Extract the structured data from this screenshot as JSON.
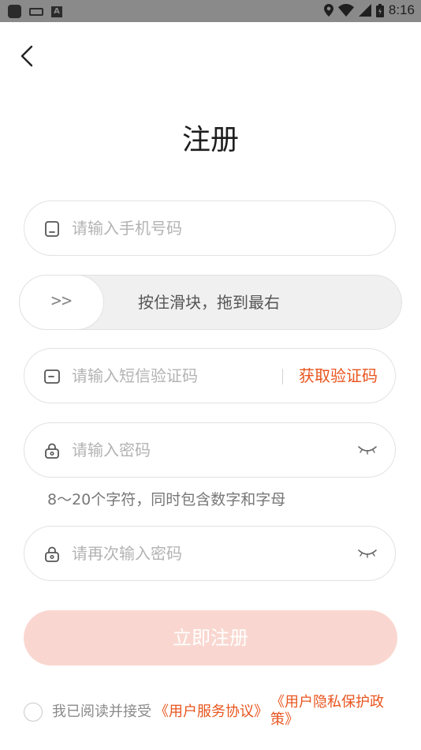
{
  "status_bar": {
    "time": "8:16",
    "app_icon_letter": "A"
  },
  "page": {
    "title": "注册"
  },
  "phone": {
    "placeholder": "请输入手机号码"
  },
  "slider": {
    "knob_label": ">>",
    "text": "按住滑块，拖到最右"
  },
  "sms": {
    "placeholder": "请输入短信验证码",
    "get_code_label": "获取验证码"
  },
  "password": {
    "placeholder": "请输入密码",
    "hint": "8～20个字符，同时包含数字和字母"
  },
  "confirm_password": {
    "placeholder": "请再次输入密码"
  },
  "submit": {
    "label": "立即注册"
  },
  "agreement": {
    "prefix": "我已阅读并接受",
    "service_link": "《用户服务协议》",
    "privacy_link": "《用户隐私保护政策》"
  },
  "colors": {
    "accent": "#e8551e",
    "button_disabled": "#f9d7d0"
  }
}
